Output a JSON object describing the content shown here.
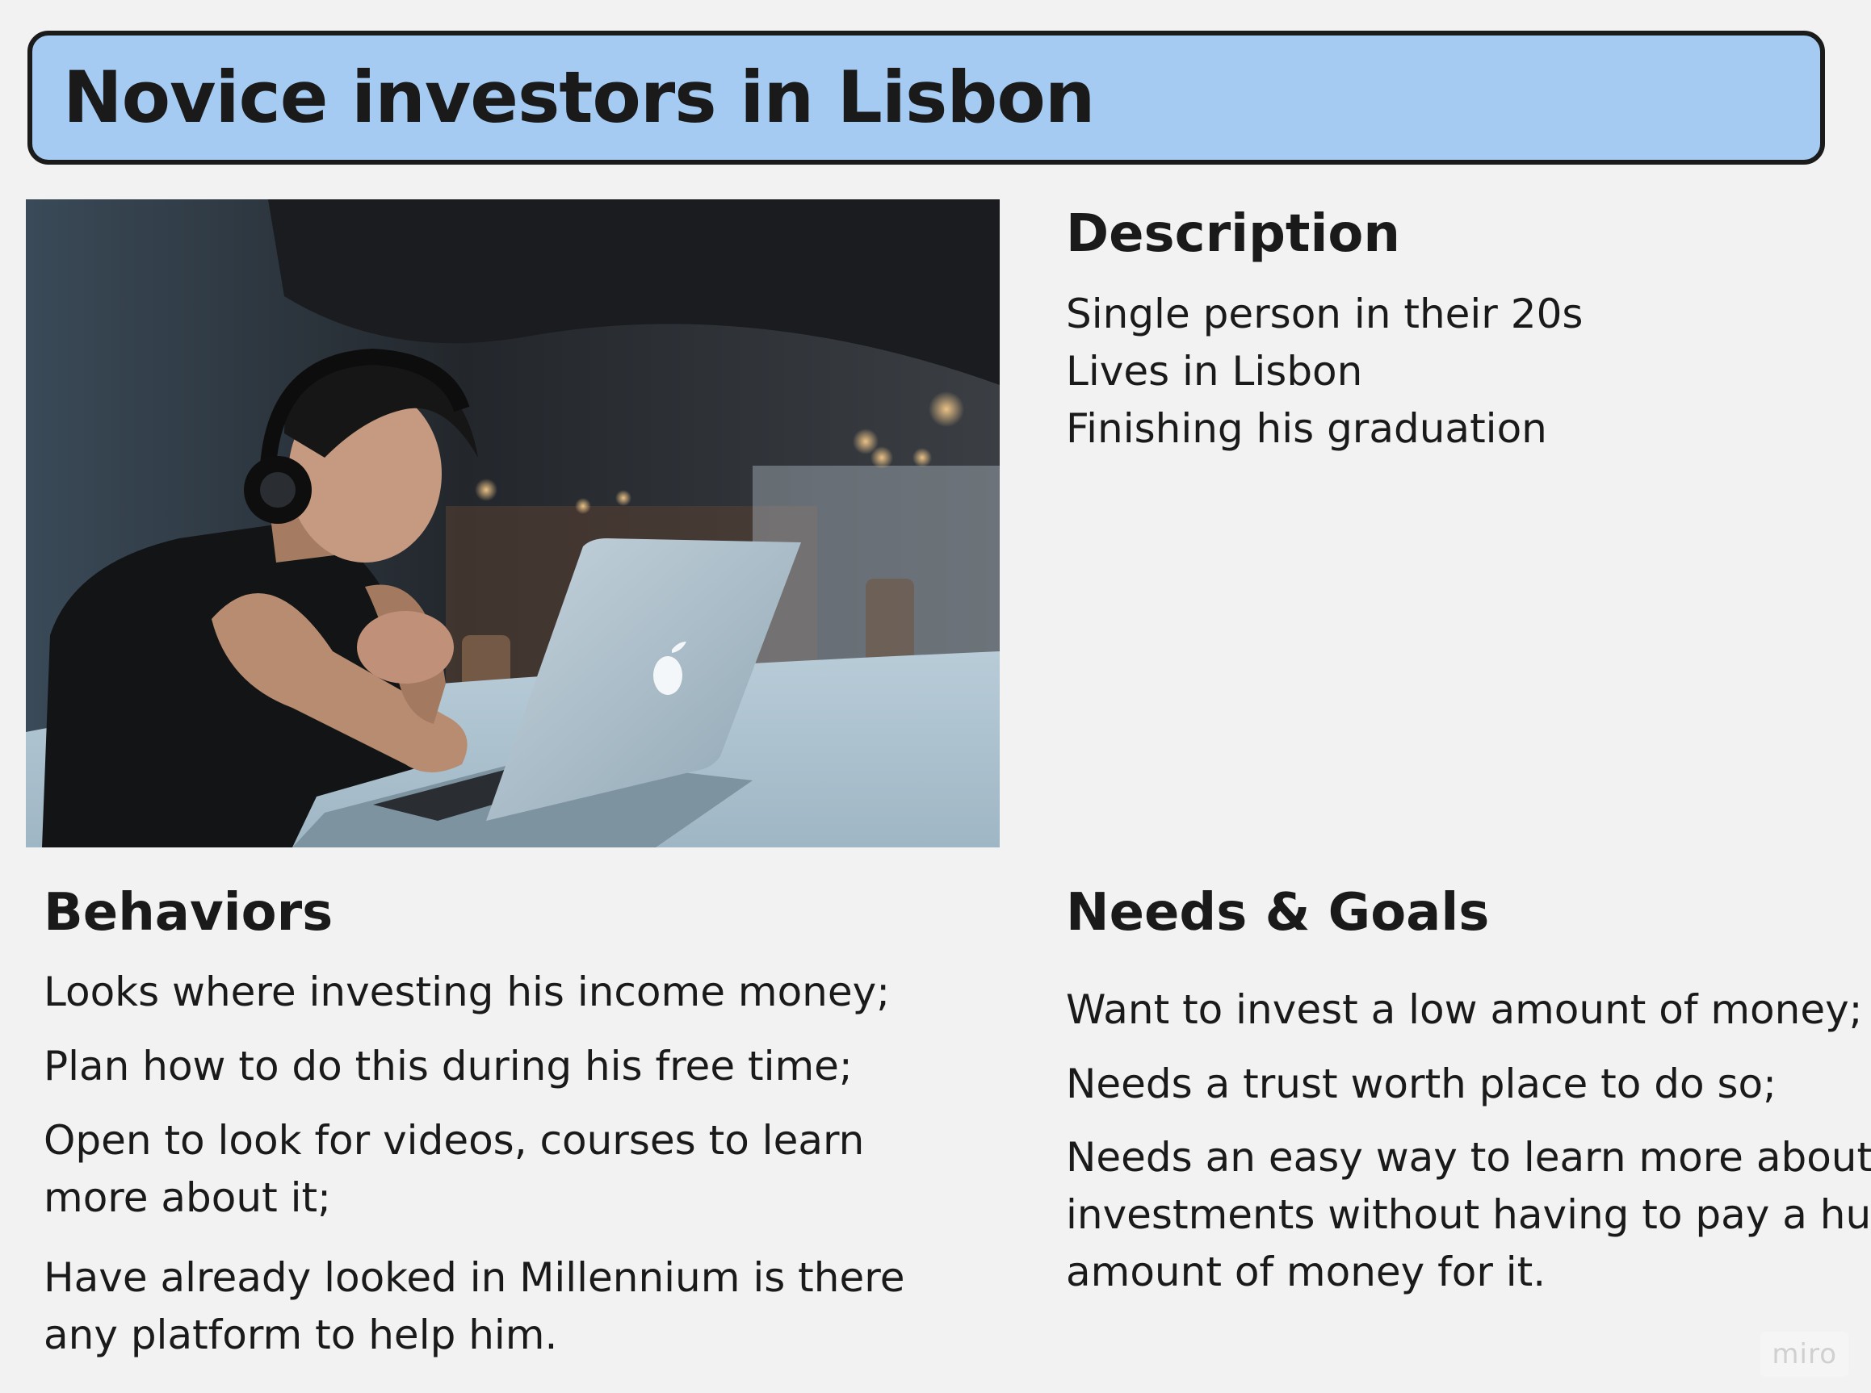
{
  "title": "Novice investors in Lisbon",
  "photo": {
    "icon": "person-at-laptop-photo"
  },
  "description": {
    "heading": "Description",
    "items": [
      "Single person in their 20s",
      "Lives in Lisbon",
      "Finishing his graduation"
    ]
  },
  "behaviors": {
    "heading": "Behaviors",
    "items": [
      {
        "lines": [
          "Looks where investing his income money;"
        ]
      },
      {
        "lines": [
          "Plan how to do this during his free time;"
        ]
      },
      {
        "lines": [
          "Open to look for videos, courses to learn",
          "more about it;"
        ]
      },
      {
        "lines": [
          "Have already looked in Millennium is there",
          "any platform to help him."
        ]
      }
    ]
  },
  "needs_goals": {
    "heading": "Needs & Goals",
    "items": [
      {
        "lines": [
          "Want to invest a low amount of money;"
        ]
      },
      {
        "lines": [
          "Needs a trust worth place to do so;"
        ]
      },
      {
        "lines": [
          "Needs an easy way to learn more about",
          "investments without having to pay a huge",
          "amount of money for it."
        ]
      }
    ]
  },
  "watermark": "miro",
  "colors": {
    "banner_fill": "#a5cbf3",
    "banner_border": "#1b1b1b",
    "background": "#f2f2f2"
  }
}
